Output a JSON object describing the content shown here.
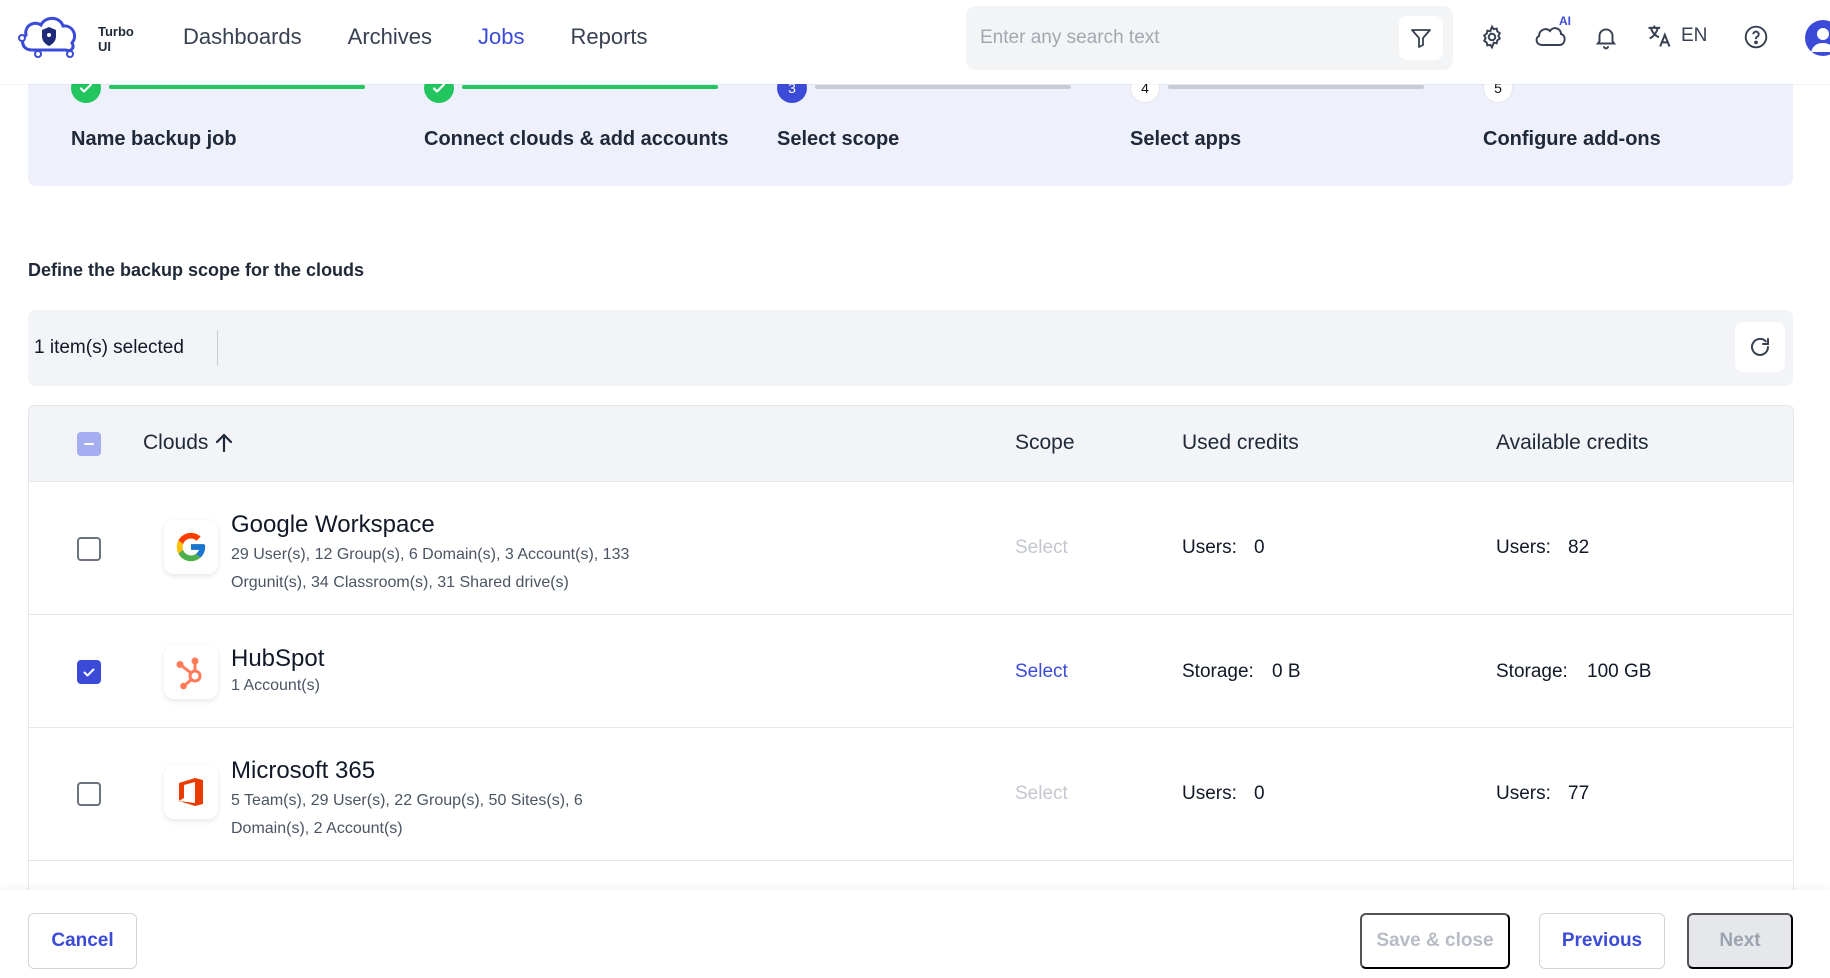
{
  "app": {
    "brand": "Turbo UI"
  },
  "nav": {
    "items": [
      {
        "label": "Dashboards",
        "active": false
      },
      {
        "label": "Archives",
        "active": false
      },
      {
        "label": "Jobs",
        "active": true
      },
      {
        "label": "Reports",
        "active": false
      }
    ]
  },
  "header": {
    "search_placeholder": "Enter any search text",
    "ai_badge": "AI",
    "language": "EN"
  },
  "stepper": {
    "steps": [
      {
        "number": "",
        "label": "Name backup job",
        "state": "done"
      },
      {
        "number": "",
        "label": "Connect clouds & add accounts",
        "state": "done"
      },
      {
        "number": "3",
        "label": "Select scope",
        "state": "current"
      },
      {
        "number": "4",
        "label": "Select apps",
        "state": "todo"
      },
      {
        "number": "5",
        "label": "Configure add-ons",
        "state": "todo"
      }
    ]
  },
  "section_title": "Define the backup scope for the clouds",
  "selection": {
    "text": "1 item(s) selected"
  },
  "table": {
    "columns": {
      "clouds": "Clouds",
      "scope": "Scope",
      "used": "Used credits",
      "available": "Available credits"
    },
    "rows": [
      {
        "name": "Google Workspace",
        "detail": "29 User(s), 12 Group(s), 6 Domain(s), 3 Account(s), 133 Orgunit(s), 34 Classroom(s), 31 Shared drive(s)",
        "checked": false,
        "scope": "Select",
        "used_label": "Users:",
        "used_value": "0",
        "available_label": "Users:",
        "available_value": "82"
      },
      {
        "name": "HubSpot",
        "detail": "1 Account(s)",
        "checked": true,
        "scope": "Select",
        "used_label": "Storage:",
        "used_value": "0 B",
        "available_label": "Storage:",
        "available_value": "100 GB"
      },
      {
        "name": "Microsoft 365",
        "detail": "5 Team(s), 29 User(s), 22 Group(s), 50 Sites(s), 6 Domain(s), 2 Account(s)",
        "checked": false,
        "scope": "Select",
        "used_label": "Users:",
        "used_value": "0",
        "available_label": "Users:",
        "available_value": "77"
      }
    ]
  },
  "footer": {
    "cancel": "Cancel",
    "save_close": "Save & close",
    "previous": "Previous",
    "next": "Next"
  },
  "colors": {
    "accent": "#3b4bd8",
    "success": "#22c55e",
    "stepper_bg": "#eef0fc"
  }
}
